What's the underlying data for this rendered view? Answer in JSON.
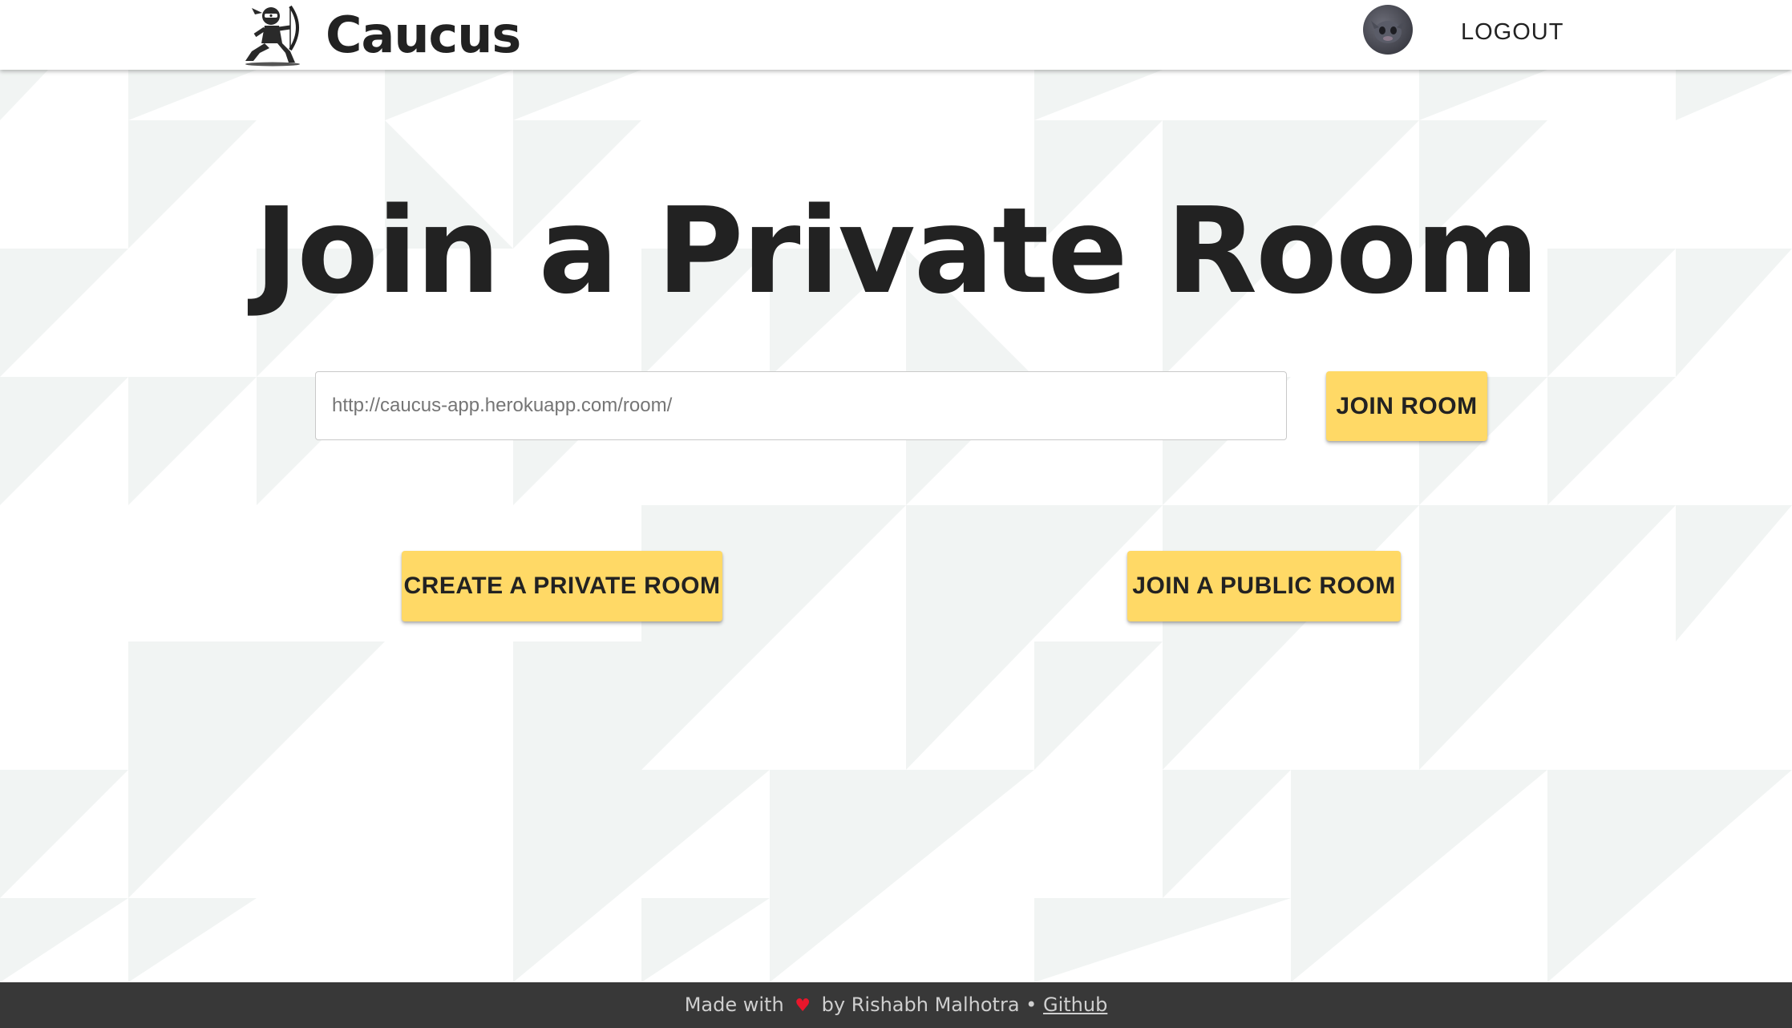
{
  "navbar": {
    "brand_name": "Caucus",
    "logout_label": "LOGOUT"
  },
  "main": {
    "headline": "Join a Private Room",
    "room_input": {
      "value": "",
      "placeholder": "http://caucus-app.herokuapp.com/room/"
    },
    "join_room_label": "JOIN ROOM",
    "create_private_room_label": "CREATE A PRIVATE ROOM",
    "join_public_room_label": "JOIN A PUBLIC ROOM"
  },
  "footer": {
    "made_with": "Made with",
    "heart_icon": "heart-icon",
    "by_author": "by Rishabh Malhotra •",
    "github_label": "Github"
  },
  "colors": {
    "accent": "#ffd966",
    "text_dark": "#222222",
    "footer_bg": "#383838",
    "pattern_light": "#f1f4f3",
    "heart": "#e8162b"
  }
}
